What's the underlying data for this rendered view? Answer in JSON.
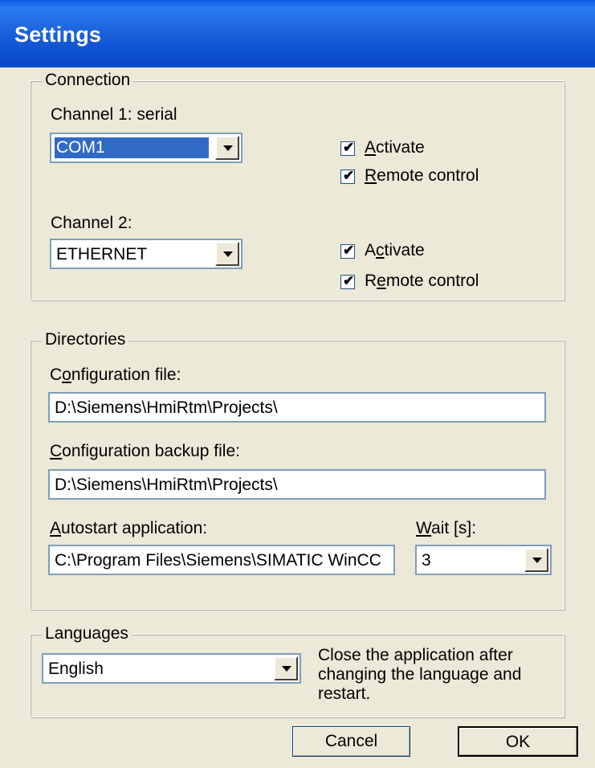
{
  "window": {
    "title": "Settings"
  },
  "connection": {
    "legend": "Connection",
    "channel1": {
      "label": "Channel 1: serial",
      "value": "COM1",
      "activate": {
        "label": "Activate",
        "accesskey": "A",
        "rest": "ctivate",
        "checked": true
      },
      "remote": {
        "label": "Remote control",
        "accesskey": "R",
        "rest": "emote control",
        "checked": true
      }
    },
    "channel2": {
      "label": "Channel 2:",
      "value": "ETHERNET",
      "activate": {
        "label": "Activate",
        "pre": "A",
        "accesskey": "c",
        "rest": "tivate",
        "checked": true
      },
      "remote": {
        "label": "Remote control",
        "pre": "R",
        "accesskey": "e",
        "rest": "mote control",
        "checked": true
      }
    }
  },
  "directories": {
    "legend": "Directories",
    "config_label": {
      "pre": "C",
      "accesskey": "o",
      "rest": "nfiguration file:"
    },
    "config_value": "D:\\Siemens\\HmiRtm\\Projects\\",
    "backup_label": {
      "accesskey": "C",
      "rest": "onfiguration backup file:"
    },
    "backup_value": "D:\\Siemens\\HmiRtm\\Projects\\",
    "autostart_label": {
      "accesskey": "A",
      "rest": "utostart application:"
    },
    "autostart_value": "C:\\Program Files\\Siemens\\SIMATIC WinCC",
    "wait_label": {
      "accesskey": "W",
      "rest": "ait [s]:"
    },
    "wait_value": "3"
  },
  "languages": {
    "legend": "Languages",
    "value": "English",
    "help": "Close the application after changing the language and restart."
  },
  "buttons": {
    "cancel": "Cancel",
    "ok": "OK"
  }
}
